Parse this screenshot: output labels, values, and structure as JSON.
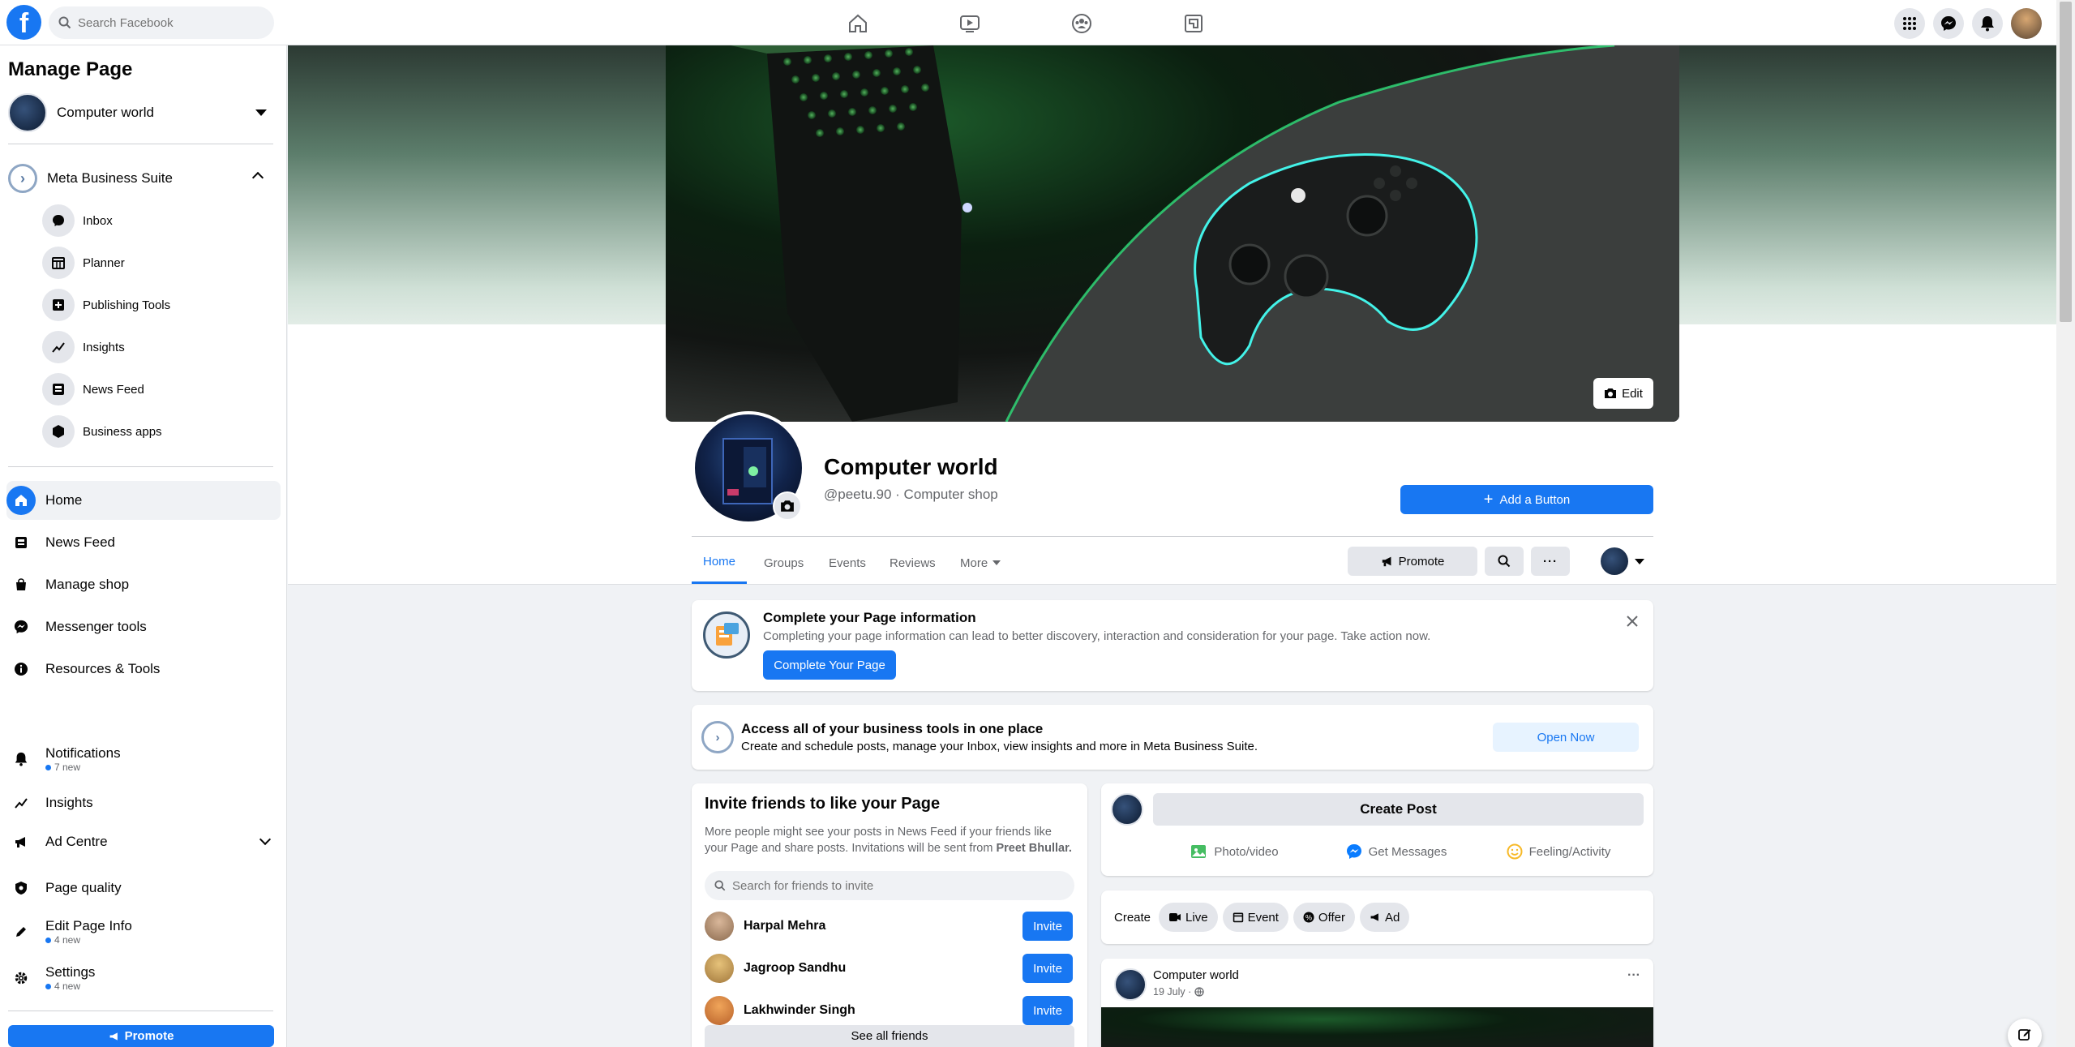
{
  "topbar": {
    "logo": "f",
    "search_placeholder": "Search Facebook",
    "nav": [
      "home-icon",
      "video-icon",
      "groups-icon",
      "gaming-icon"
    ],
    "right": [
      "menu-grid-icon",
      "messenger-icon",
      "notifications-icon",
      "account-avatar"
    ]
  },
  "sidebar": {
    "title": "Manage Page",
    "page_name": "Computer world",
    "business_suite": "Meta Business Suite",
    "suite_items": [
      {
        "label": "Inbox",
        "icon": "chat-bubble-icon"
      },
      {
        "label": "Planner",
        "icon": "calendar-icon"
      },
      {
        "label": "Publishing Tools",
        "icon": "publishing-icon"
      },
      {
        "label": "Insights",
        "icon": "insights-icon"
      },
      {
        "label": "News Feed",
        "icon": "news-feed-icon"
      },
      {
        "label": "Business apps",
        "icon": "cube-icon"
      }
    ],
    "items": [
      {
        "label": "Home",
        "sub": ""
      },
      {
        "label": "News Feed",
        "sub": ""
      },
      {
        "label": "Manage shop",
        "sub": ""
      },
      {
        "label": "Messenger tools",
        "sub": ""
      },
      {
        "label": "Resources & Tools",
        "sub": ""
      },
      {
        "label": "Notifications",
        "sub": "7 new"
      },
      {
        "label": "Insights",
        "sub": ""
      },
      {
        "label": "Ad Centre",
        "sub": ""
      },
      {
        "label": "Page quality",
        "sub": ""
      },
      {
        "label": "Edit Page Info",
        "sub": "4 new"
      },
      {
        "label": "Settings",
        "sub": "4 new"
      }
    ],
    "promote": "Promote"
  },
  "header": {
    "cover_edit": "Edit",
    "page_name": "Computer world",
    "handle": "@peetu.90 · Computer shop",
    "add_button": "Add a Button",
    "tabs": [
      "Home",
      "Groups",
      "Events",
      "Reviews",
      "More"
    ],
    "promote": "Promote"
  },
  "complete_info": {
    "title": "Complete your Page information",
    "body": "Completing your page information can lead to better discovery, interaction and consideration for your page. Take action now.",
    "button": "Complete Your Page"
  },
  "business_tools": {
    "title": "Access all of your business tools in one place",
    "body": "Create and schedule posts, manage your Inbox, view insights and more in Meta Business Suite.",
    "button": "Open Now"
  },
  "invite": {
    "title": "Invite friends to like your Page",
    "body_1": "More people might see your posts in News Feed if your friends like",
    "body_2": "your Page and share posts. Invitations will be sent from",
    "sender": "Preet Bhullar.",
    "search_placeholder": "Search for friends to invite",
    "friends": [
      "Harpal Mehra",
      "Jagroop Sandhu",
      "Lakhwinder Singh"
    ],
    "invite_label": "Invite",
    "see_all": "See all friends"
  },
  "composer": {
    "create_post": "Create Post",
    "actions": [
      "Photo/video",
      "Get Messages",
      "Feeling/Activity"
    ]
  },
  "create_bar": {
    "label": "Create",
    "chips": [
      "Live",
      "Event",
      "Offer",
      "Ad"
    ]
  },
  "post": {
    "author": "Computer world",
    "date": "19 July ·",
    "more": "···"
  },
  "colors": {
    "brand": "#1877f2",
    "bg": "#f0f2f5"
  }
}
